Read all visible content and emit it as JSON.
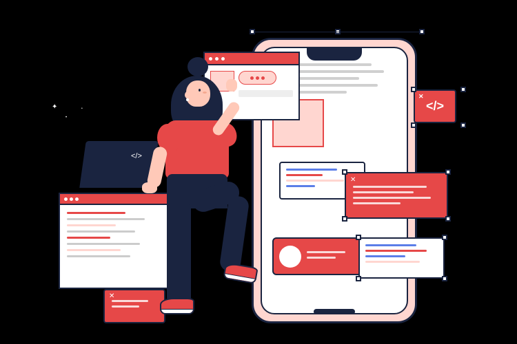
{
  "illustration": {
    "type": "app-development-concept",
    "elements": {
      "phone": "smartphone-mockup",
      "person": "female-developer",
      "laptop": "laptop-device",
      "code_symbol": "</>",
      "windows": [
        "browser-window-top",
        "browser-window-bottom",
        "code-snippet-cards"
      ]
    },
    "colors": {
      "primary": "#e64848",
      "dark": "#1a2440",
      "accent": "#5b7ee8",
      "skin": "#ffc9b8",
      "light": "#ffd6d0"
    }
  }
}
